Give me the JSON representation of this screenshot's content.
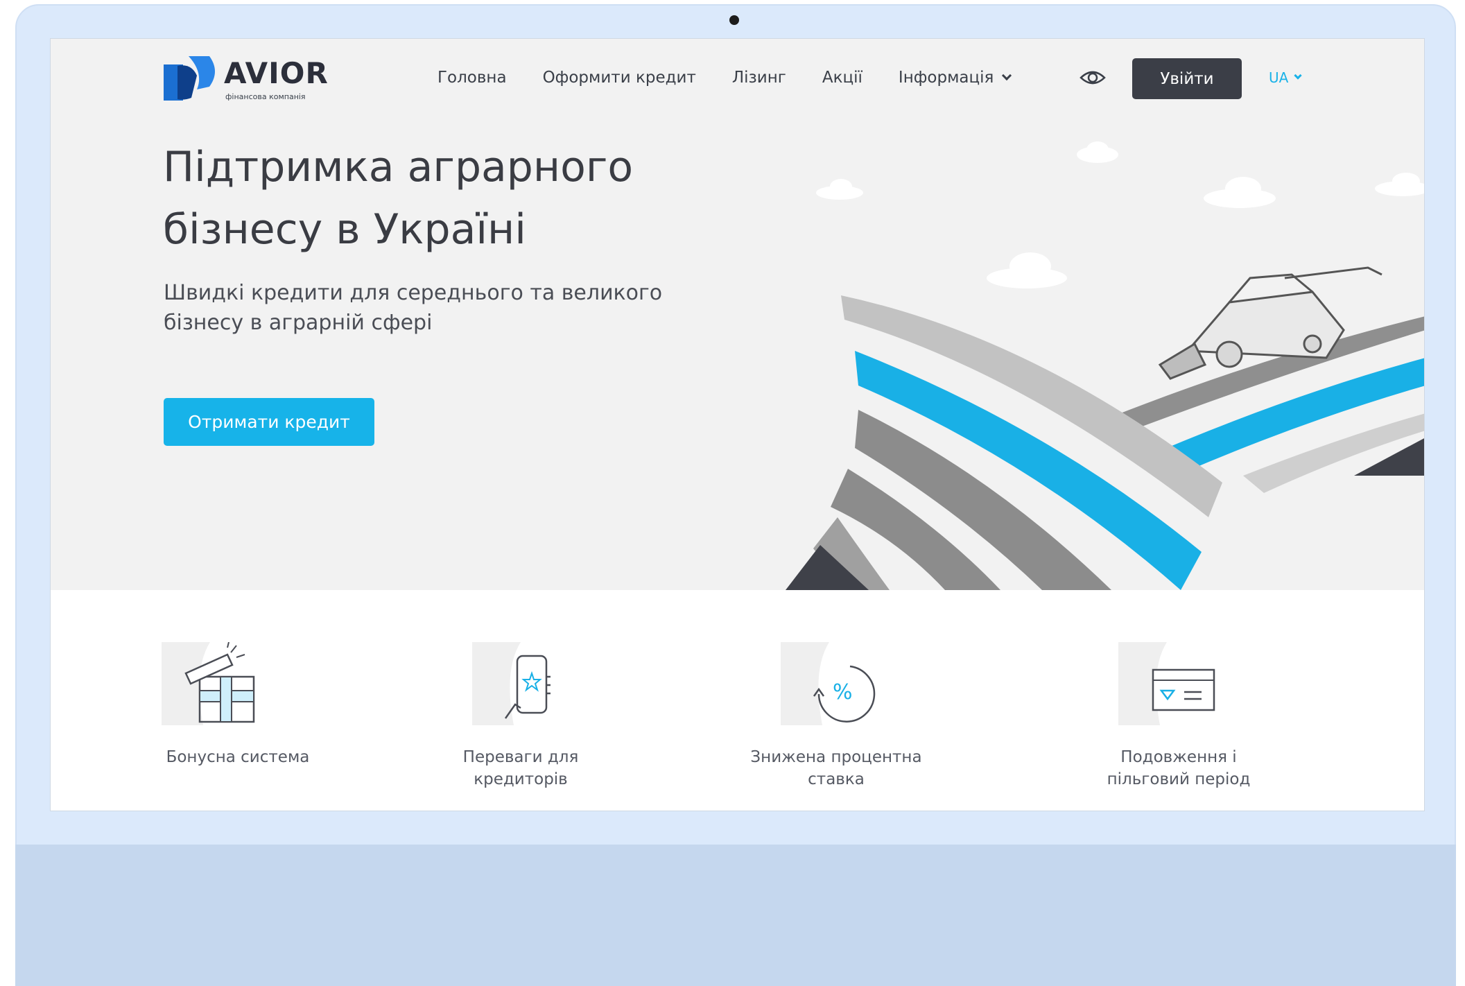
{
  "brand": {
    "name": "AVIOR",
    "tagline": "фінансова компанія",
    "colors": {
      "accent": "#17b3e9",
      "dark": "#3b3e47",
      "logo_blue": "#1b6fd1"
    }
  },
  "nav": {
    "items": [
      {
        "label": "Головна"
      },
      {
        "label": "Оформити кредит"
      },
      {
        "label": "Лізинг"
      },
      {
        "label": "Акції"
      },
      {
        "label": "Інформація"
      }
    ],
    "accessibility_icon": "eye-icon",
    "login_label": "Увійти",
    "language": "UA"
  },
  "hero": {
    "title": "Підтримка аграрного бізнесу в Україні",
    "subtitle": "Швидкі кредити для середнього та великого бізнесу в аграрній сфері",
    "cta_label": "Отримати кредит"
  },
  "features": [
    {
      "icon": "gift-icon",
      "label": "Бонусна система"
    },
    {
      "icon": "phone-star-icon",
      "label": "Переваги для\nкредиторів"
    },
    {
      "icon": "percent-icon",
      "label": "Знижена процентна\nставка"
    },
    {
      "icon": "card-icon",
      "label": "Подовження і\nпільговий період"
    }
  ]
}
